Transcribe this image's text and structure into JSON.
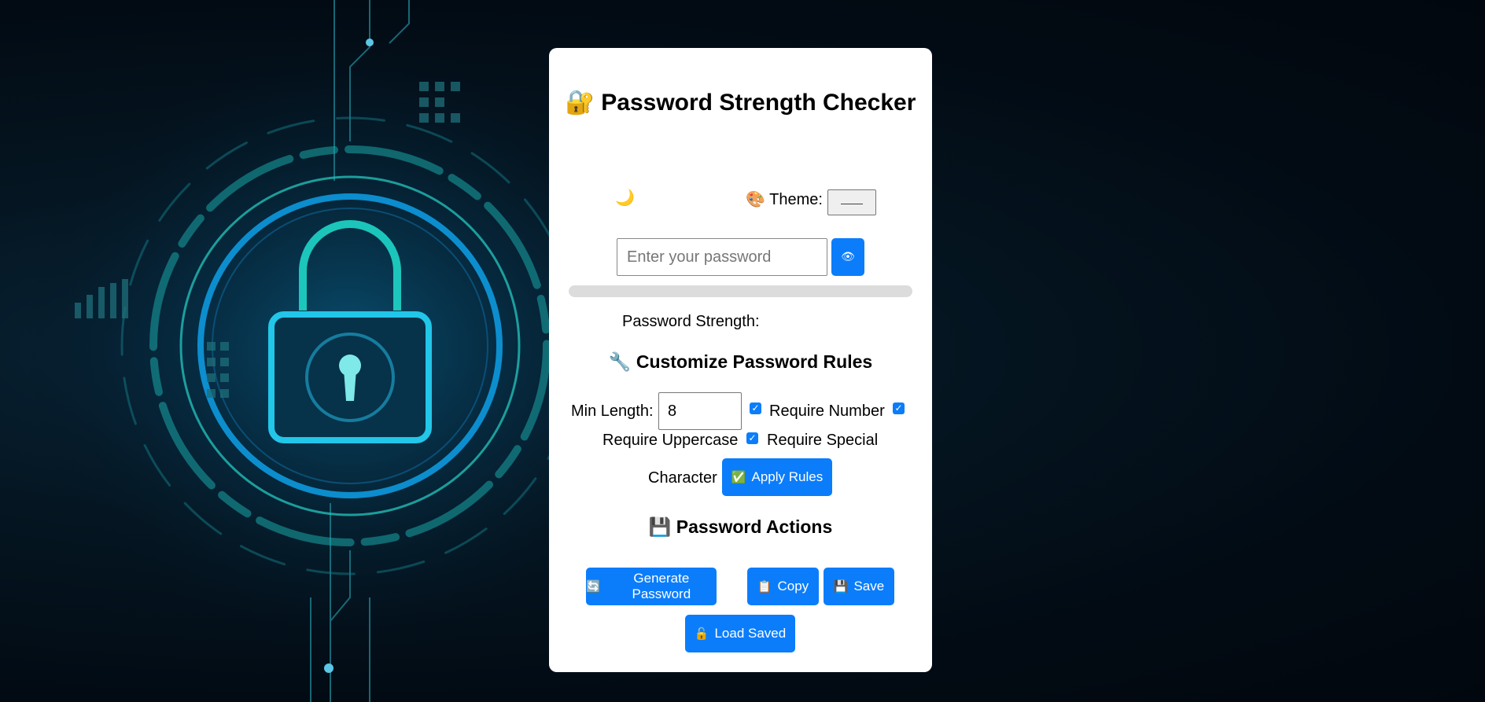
{
  "app": {
    "title": "Password Strength Checker",
    "title_icon": "🔐"
  },
  "theme": {
    "toggle_icon": "🌙",
    "label_icon": "🎨",
    "label": "Theme:",
    "selected_value": "——"
  },
  "password": {
    "placeholder": "Enter your password",
    "value": "",
    "toggle_visibility_icon": "👁",
    "strength_label": "Password Strength:",
    "strength_value": "",
    "strength_fraction": 0
  },
  "rules": {
    "heading_icon": "🔧",
    "heading": "Customize Password Rules",
    "min_length_label": "Min Length:",
    "min_length_value": "8",
    "require_number": {
      "label": "Require Number",
      "checked": true
    },
    "require_uppercase": {
      "label": "Require Uppercase",
      "checked": true
    },
    "require_special": {
      "label": "Require Special Character",
      "line1": "Require Special",
      "line2": "Character",
      "checked": true
    },
    "apply_icon": "✅",
    "apply_label": "Apply Rules"
  },
  "actions": {
    "heading_icon": "💾",
    "heading": "Password Actions",
    "generate": {
      "icon": "🔄",
      "label": "Generate Password"
    },
    "copy": {
      "icon": "📋",
      "label": "Copy"
    },
    "save": {
      "icon": "💾",
      "label": "Save"
    },
    "load": {
      "icon": "🔓",
      "label": "Load Saved"
    }
  },
  "colors": {
    "accent": "#0b7dfb",
    "card_bg": "#ffffff",
    "background": "#020b14",
    "glow": "#1fd6c8"
  }
}
